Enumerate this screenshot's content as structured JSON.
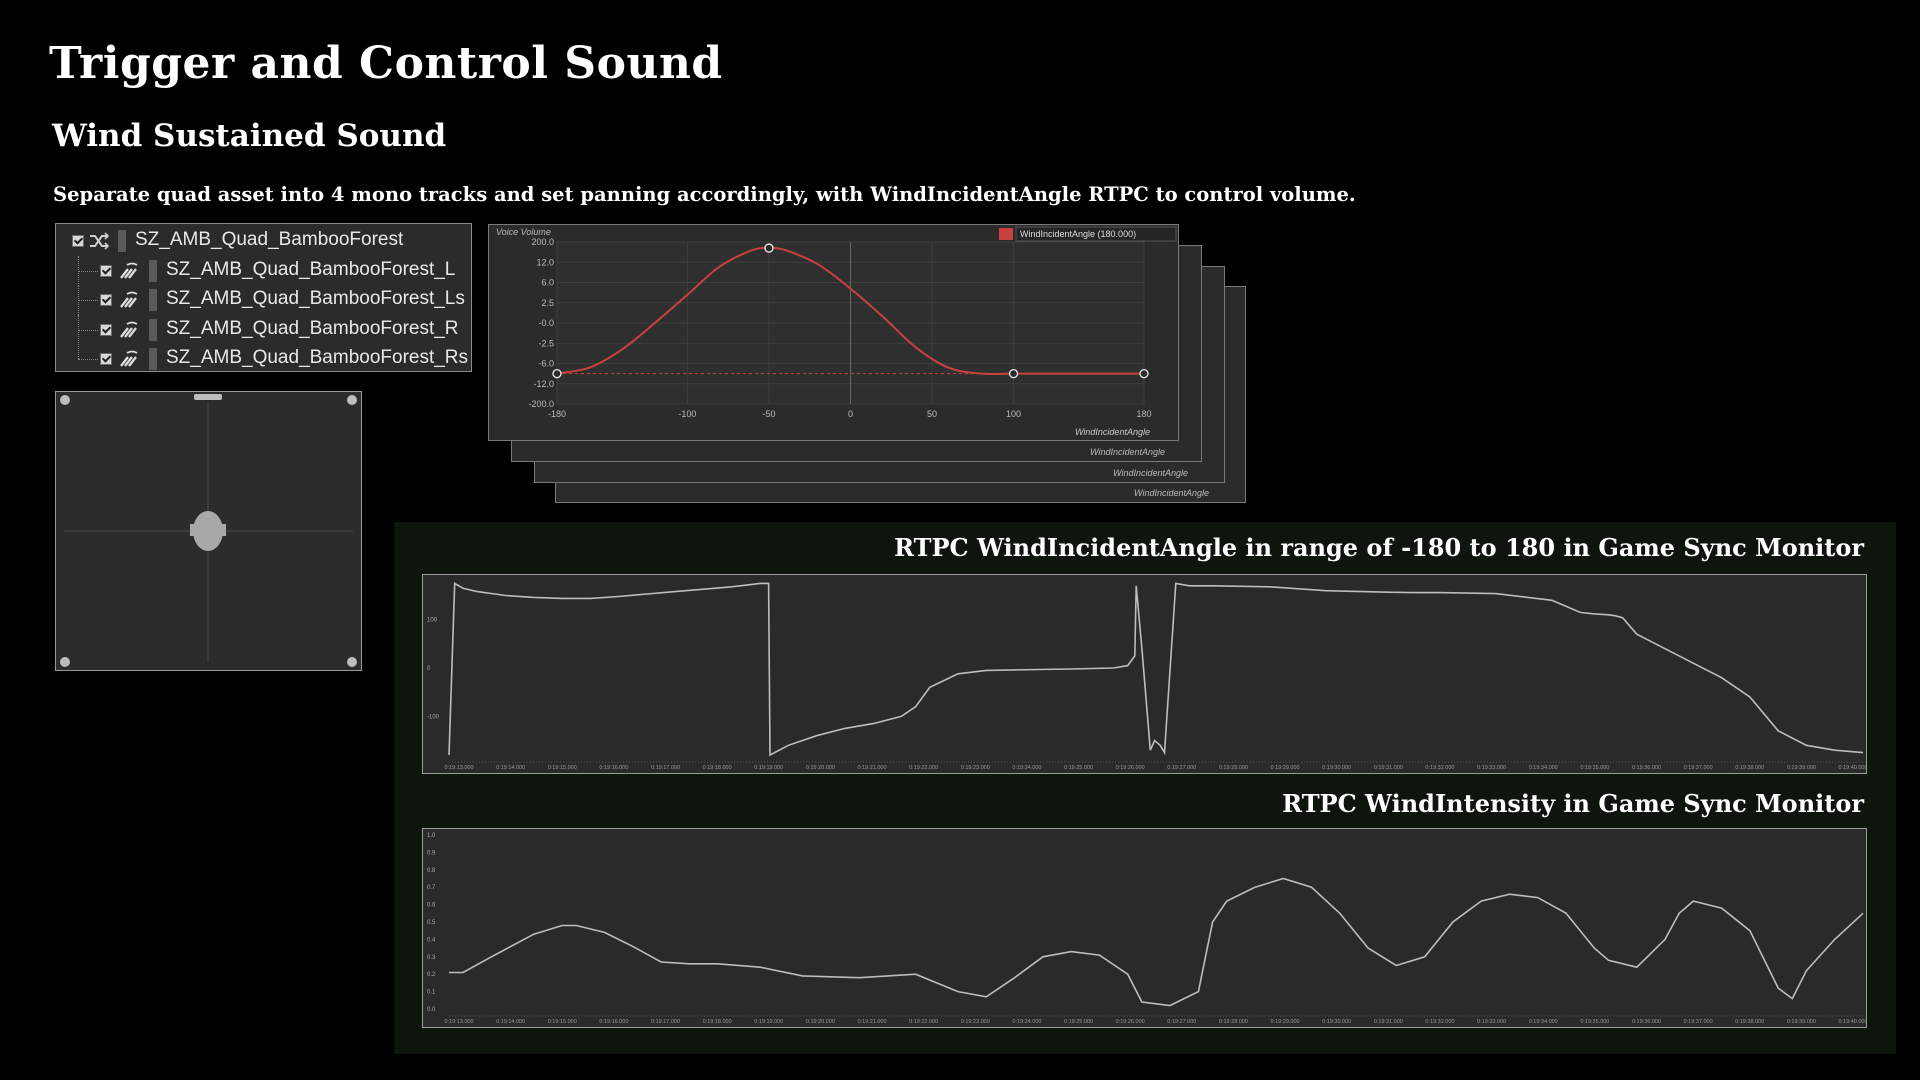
{
  "page": {
    "title": "Trigger and Control Sound",
    "section_title": "Wind Sustained Sound",
    "description": "Separate quad asset into 4 mono tracks and set panning accordingly, with WindIncidentAngle RTPC to control volume."
  },
  "tree": {
    "parent": {
      "label": "SZ_AMB_Quad_BambooForest",
      "icon": "random-container-icon",
      "checked": true
    },
    "children": [
      {
        "label": "SZ_AMB_Quad_BambooForest_L",
        "icon": "sound-sfx-icon",
        "checked": true
      },
      {
        "label": "SZ_AMB_Quad_BambooForest_Ls",
        "icon": "sound-sfx-icon",
        "checked": true
      },
      {
        "label": "SZ_AMB_Quad_BambooForest_R",
        "icon": "sound-sfx-icon",
        "checked": true
      },
      {
        "label": "SZ_AMB_Quad_BambooForest_Rs",
        "icon": "sound-sfx-icon",
        "checked": true
      }
    ]
  },
  "rtpc_curve": {
    "y_label": "Voice Volume",
    "x_label": "WindIncidentAngle",
    "legend": "WindIncidentAngle (180.000)",
    "curve_color": "#c94040",
    "y_ticks": [
      "200.0",
      "12.0",
      "6.0",
      "2.5",
      "-0.0",
      "-2.5",
      "-6.0",
      "-12.0",
      "-200.0"
    ],
    "x_ticks": [
      "-180",
      "-100",
      "-50",
      "0",
      "50",
      "100",
      "180"
    ],
    "back_window_label": "WindIncidentAngle"
  },
  "monitor": {
    "angle_title": "RTPC WindIncidentAngle in range of -180 to 180 in Game Sync Monitor",
    "intensity_title": "RTPC WindIntensity in Game Sync Monitor",
    "angle_y_ticks": [
      "100",
      "0",
      "-100"
    ],
    "intensity_y_ticks": [
      "1.0",
      "0.9",
      "0.8",
      "0.7",
      "0.6",
      "0.5",
      "0.4",
      "0.3",
      "0.2",
      "0.1",
      "0.0"
    ],
    "time_ticks": [
      "0:19:13.000",
      "0:19:14.000",
      "0:19:15.000",
      "0:19:16.000",
      "0:19:17.000",
      "0:19:18.000",
      "0:19:19.000",
      "0:19:20.000",
      "0:19:21.000",
      "0:19:22.000",
      "0:19:23.000",
      "0:19:24.000",
      "0:19:25.000",
      "0:19:26.000",
      "0:19:27.000",
      "0:19:28.000",
      "0:19:29.000",
      "0:19:30.000",
      "0:19:31.000",
      "0:19:32.000",
      "0:19:33.000",
      "0:19:34.000",
      "0:19:35.000",
      "0:19:36.000",
      "0:19:37.000",
      "0:19:38.000",
      "0:19:39.000",
      "0:19:40.000"
    ]
  },
  "chart_data": [
    {
      "type": "line",
      "name": "rtpc-volume-curve",
      "x": [
        -180,
        -160,
        -140,
        -120,
        -100,
        -80,
        -60,
        -50,
        -40,
        -20,
        0,
        20,
        40,
        60,
        80,
        100,
        120,
        140,
        160,
        180
      ],
      "y_norm": [
        0.15,
        0.18,
        0.27,
        0.4,
        0.54,
        0.68,
        0.76,
        0.77,
        0.76,
        0.69,
        0.57,
        0.43,
        0.28,
        0.18,
        0.15,
        0.15,
        0.15,
        0.15,
        0.15,
        0.15
      ],
      "control_points_x": [
        -180,
        -50,
        100,
        180
      ],
      "x_range": [
        -180,
        180
      ]
    },
    {
      "type": "line",
      "name": "wind-incident-angle",
      "ylim": [
        -180,
        180
      ],
      "t": [
        0,
        0.4,
        1,
        2,
        4,
        6,
        8,
        10,
        12,
        14,
        16,
        20,
        22,
        22.6,
        22.7,
        24,
        26,
        28,
        30,
        32,
        33,
        34,
        36,
        38,
        40,
        44,
        47,
        48,
        48.5,
        48.6,
        49,
        49.6,
        49.9,
        50.3,
        50.6,
        51.4,
        52,
        52.4,
        54,
        58,
        62,
        66,
        68,
        70,
        74,
        78,
        80,
        81,
        82,
        82.5,
        83,
        84,
        86,
        88,
        90,
        92,
        94,
        96,
        98,
        100
      ],
      "v": [
        -180,
        175,
        165,
        158,
        150,
        146,
        144,
        144,
        148,
        153,
        158,
        168,
        175,
        175,
        -180,
        -160,
        -140,
        -125,
        -115,
        -100,
        -80,
        -40,
        -12,
        -5,
        -4,
        -2,
        0,
        5,
        25,
        170,
        40,
        -170,
        -150,
        -160,
        -175,
        175,
        172,
        170,
        170,
        168,
        160,
        157,
        156,
        156,
        154,
        140,
        115,
        112,
        110,
        108,
        104,
        70,
        40,
        10,
        -20,
        -60,
        -130,
        -160,
        -170,
        -175
      ]
    },
    {
      "type": "line",
      "name": "wind-intensity",
      "ylim": [
        0,
        1
      ],
      "t": [
        0,
        1,
        3,
        6,
        8,
        9,
        11,
        13,
        15,
        17,
        19,
        22,
        25,
        29,
        33,
        36,
        38,
        40,
        42,
        44,
        46,
        48,
        49,
        51,
        53,
        54,
        55,
        57,
        59,
        61,
        63,
        65,
        67,
        69,
        71,
        73,
        75,
        77,
        79,
        80,
        81,
        82,
        84,
        86,
        87,
        88,
        90,
        92,
        94,
        95,
        96,
        98,
        100
      ],
      "v": [
        0.21,
        0.21,
        0.3,
        0.43,
        0.48,
        0.48,
        0.44,
        0.36,
        0.27,
        0.26,
        0.26,
        0.24,
        0.19,
        0.18,
        0.2,
        0.1,
        0.07,
        0.18,
        0.3,
        0.33,
        0.31,
        0.2,
        0.04,
        0.02,
        0.1,
        0.5,
        0.62,
        0.7,
        0.75,
        0.7,
        0.55,
        0.35,
        0.25,
        0.3,
        0.5,
        0.62,
        0.66,
        0.64,
        0.55,
        0.45,
        0.35,
        0.28,
        0.24,
        0.4,
        0.55,
        0.62,
        0.58,
        0.45,
        0.12,
        0.06,
        0.22,
        0.4,
        0.55
      ]
    }
  ]
}
